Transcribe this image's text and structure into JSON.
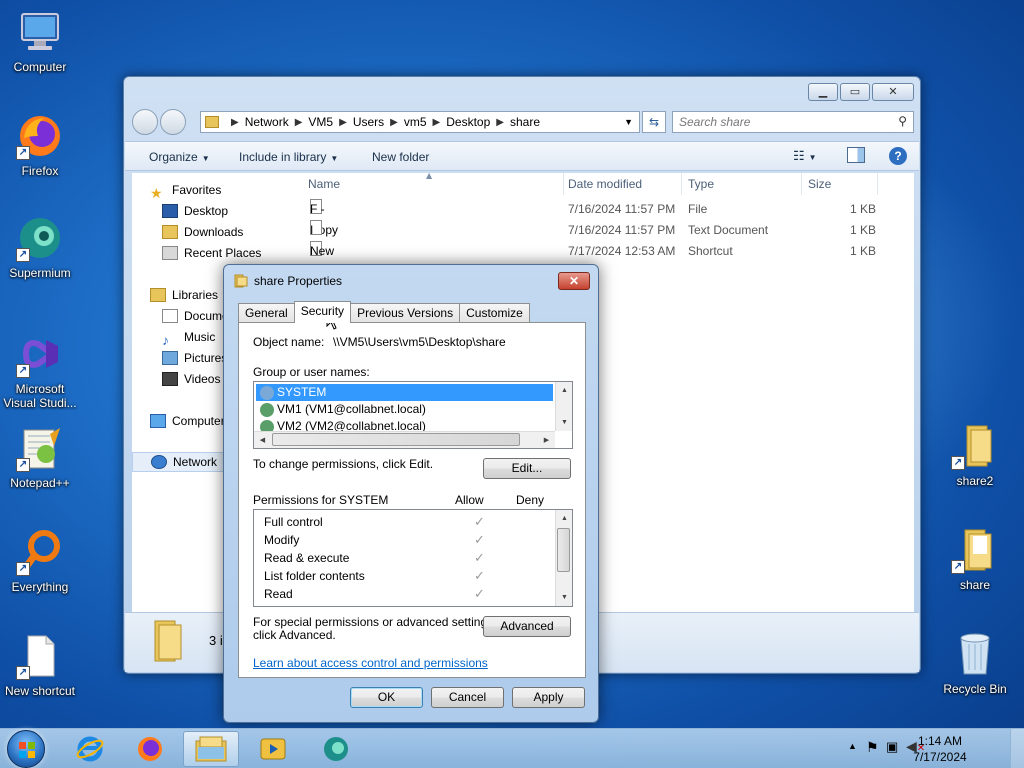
{
  "desktop": {
    "icons_left": [
      {
        "label": "Computer"
      },
      {
        "label": "Firefox"
      },
      {
        "label": "Supermium"
      },
      {
        "label": "Microsoft Visual Studi..."
      },
      {
        "label": "Notepad++"
      },
      {
        "label": "Everything"
      },
      {
        "label": "New shortcut"
      }
    ],
    "icons_right": [
      {
        "label": "share2"
      },
      {
        "label": "share"
      },
      {
        "label": "Recycle Bin"
      }
    ]
  },
  "explorer": {
    "breadcrumb": [
      "Network",
      "VM5",
      "Users",
      "vm5",
      "Desktop",
      "share"
    ],
    "search_placeholder": "Search share",
    "toolbar": {
      "organize": "Organize",
      "include_in_library": "Include in library",
      "new_folder": "New folder"
    },
    "nav": {
      "favorites": "Favorites",
      "desktop": "Desktop",
      "downloads": "Downloads",
      "recent_places": "Recent Places",
      "libraries": "Libraries",
      "documents": "Docume",
      "music": "Music",
      "pictures": "Pictures",
      "videos": "Videos",
      "computer": "Computer",
      "network": "Network"
    },
    "columns": {
      "name": "Name",
      "date_modified": "Date modified",
      "type": "Type",
      "size": "Size"
    },
    "files": [
      {
        "name": "F - Copy",
        "date": "7/16/2024 11:57 PM",
        "type": "File",
        "size": "1 KB"
      },
      {
        "name": "I",
        "date": "7/16/2024 11:57 PM",
        "type": "Text Document",
        "size": "1 KB"
      },
      {
        "name": "New shortcut",
        "date": "7/17/2024 12:53 AM",
        "type": "Shortcut",
        "size": "1 KB"
      }
    ],
    "details_count": "3 i"
  },
  "dialog": {
    "title": "share Properties",
    "tabs": [
      "General",
      "Security",
      "Previous Versions",
      "Customize"
    ],
    "object_name_label": "Object name:",
    "object_name_value": "\\\\VM5\\Users\\vm5\\Desktop\\share",
    "group_label": "Group or user names:",
    "users": [
      "SYSTEM",
      "VM1 (VM1@collabnet.local)",
      "VM2 (VM2@collabnet.local)"
    ],
    "change_text": "To change permissions, click Edit.",
    "edit_button": "Edit...",
    "permissions_for": "Permissions for SYSTEM",
    "allow_header": "Allow",
    "deny_header": "Deny",
    "permissions": [
      "Full control",
      "Modify",
      "Read & execute",
      "List folder contents",
      "Read"
    ],
    "advanced_text_1": "For special permissions or advanced settings,",
    "advanced_text_2": "click Advanced.",
    "advanced_button": "Advanced",
    "learn_link": "Learn about access control and permissions",
    "ok": "OK",
    "cancel": "Cancel",
    "apply": "Apply"
  },
  "taskbar": {
    "time": "1:14 AM",
    "date": "7/17/2024"
  }
}
